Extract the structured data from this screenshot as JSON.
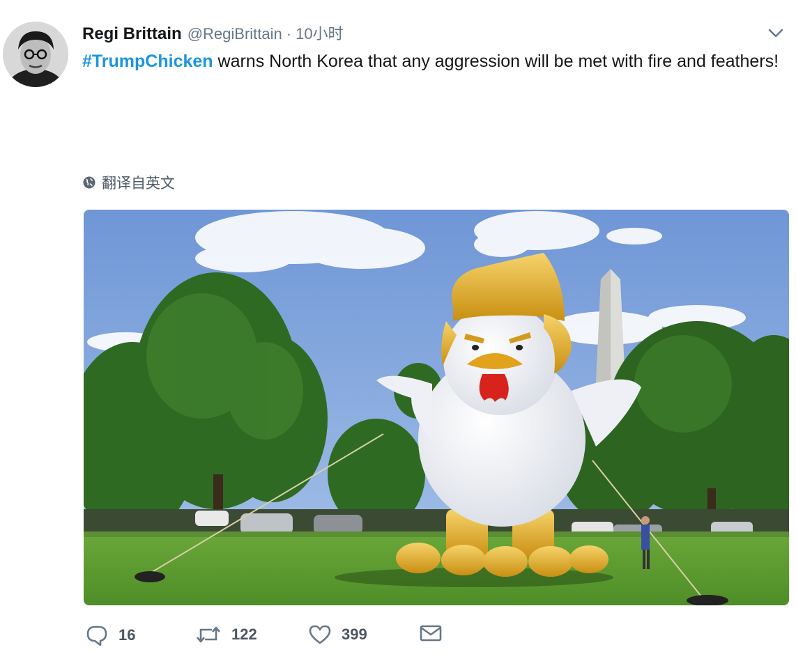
{
  "tweet": {
    "author_name": "Regi Brittain",
    "handle": "@RegiBrittain",
    "separator": "·",
    "time": "10小时",
    "hashtag": "#TrumpChicken",
    "text": " warns North Korea that any aggression will be met with fire and feathers!",
    "translate_label": "翻译自英文",
    "menu_icon": "chevron-down-icon"
  },
  "media": {
    "subject": "inflatable chicken with golden hair in a park, monument behind"
  },
  "actions": {
    "reply_count": "16",
    "retweet_count": "122",
    "like_count": "399",
    "icons": [
      "reply-icon",
      "retweet-icon",
      "heart-icon",
      "message-icon"
    ]
  },
  "colors": {
    "link": "#1b95e0",
    "secondary_text": "#657786",
    "icon_gray": "#657786"
  }
}
